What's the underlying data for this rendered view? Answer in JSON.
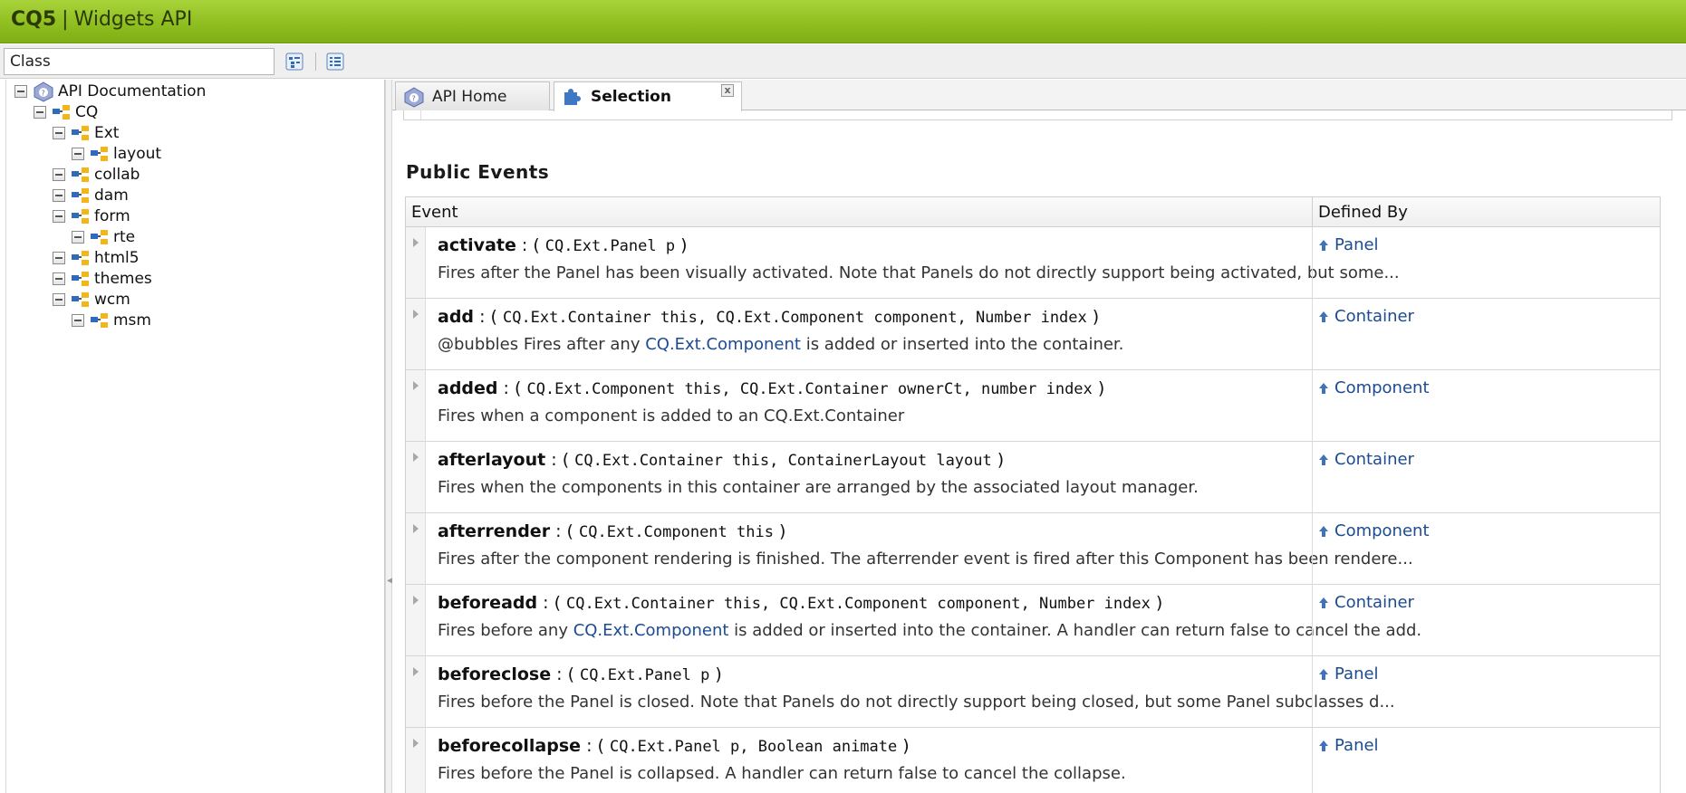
{
  "header": {
    "brand": "CQ5",
    "separator": "|",
    "title": "Widgets API"
  },
  "toolbar": {
    "class_input_value": "Class",
    "class_input_placeholder": "Class"
  },
  "tree": [
    {
      "label": "API Documentation"
    },
    {
      "label": "CQ"
    },
    {
      "label": "Ext"
    },
    {
      "label": "layout"
    },
    {
      "label": "collab"
    },
    {
      "label": "dam"
    },
    {
      "label": "form"
    },
    {
      "label": "rte"
    },
    {
      "label": "html5"
    },
    {
      "label": "themes"
    },
    {
      "label": "wcm"
    },
    {
      "label": "msm"
    }
  ],
  "tabs": [
    {
      "label": "API Home"
    },
    {
      "label": "Selection",
      "close": "x"
    }
  ],
  "section_title": "Public Events",
  "table_headers": {
    "event": "Event",
    "defined_by": "Defined By"
  },
  "events": [
    {
      "name": "activate",
      "params": "CQ.Ext.Panel p",
      "desc_pre": "Fires after the Panel has been visually activated. Note that Panels do not directly support being activated, but some...",
      "desc_link": "",
      "desc_post": "",
      "defined_by": "Panel"
    },
    {
      "name": "add",
      "params": "CQ.Ext.Container this, CQ.Ext.Component component, Number index",
      "desc_pre": "@bubbles Fires after any ",
      "desc_link": "CQ.Ext.Component",
      "desc_post": " is added or inserted into the container.",
      "defined_by": "Container"
    },
    {
      "name": "added",
      "params": "CQ.Ext.Component this, CQ.Ext.Container ownerCt, number index",
      "desc_pre": "Fires when a component is added to an CQ.Ext.Container",
      "desc_link": "",
      "desc_post": "",
      "defined_by": "Component"
    },
    {
      "name": "afterlayout",
      "params": "CQ.Ext.Container this, ContainerLayout layout",
      "desc_pre": "Fires when the components in this container are arranged by the associated layout manager.",
      "desc_link": "",
      "desc_post": "",
      "defined_by": "Container"
    },
    {
      "name": "afterrender",
      "params": "CQ.Ext.Component this",
      "desc_pre": "Fires after the component rendering is finished. The afterrender event is fired after this Component has been rendere...",
      "desc_link": "",
      "desc_post": "",
      "defined_by": "Component"
    },
    {
      "name": "beforeadd",
      "params": "CQ.Ext.Container this, CQ.Ext.Component component, Number index",
      "desc_pre": "Fires before any ",
      "desc_link": "CQ.Ext.Component",
      "desc_post": " is added or inserted into the container. A handler can return false to cancel the add.",
      "defined_by": "Container"
    },
    {
      "name": "beforeclose",
      "params": "CQ.Ext.Panel p",
      "desc_pre": "Fires before the Panel is closed. Note that Panels do not directly support being closed, but some Panel subclasses d...",
      "desc_link": "",
      "desc_post": "",
      "defined_by": "Panel"
    },
    {
      "name": "beforecollapse",
      "params": "CQ.Ext.Panel p, Boolean animate",
      "desc_pre": "Fires before the Panel is collapsed. A handler can return false to cancel the collapse.",
      "desc_link": "",
      "desc_post": "",
      "defined_by": "Panel"
    }
  ]
}
